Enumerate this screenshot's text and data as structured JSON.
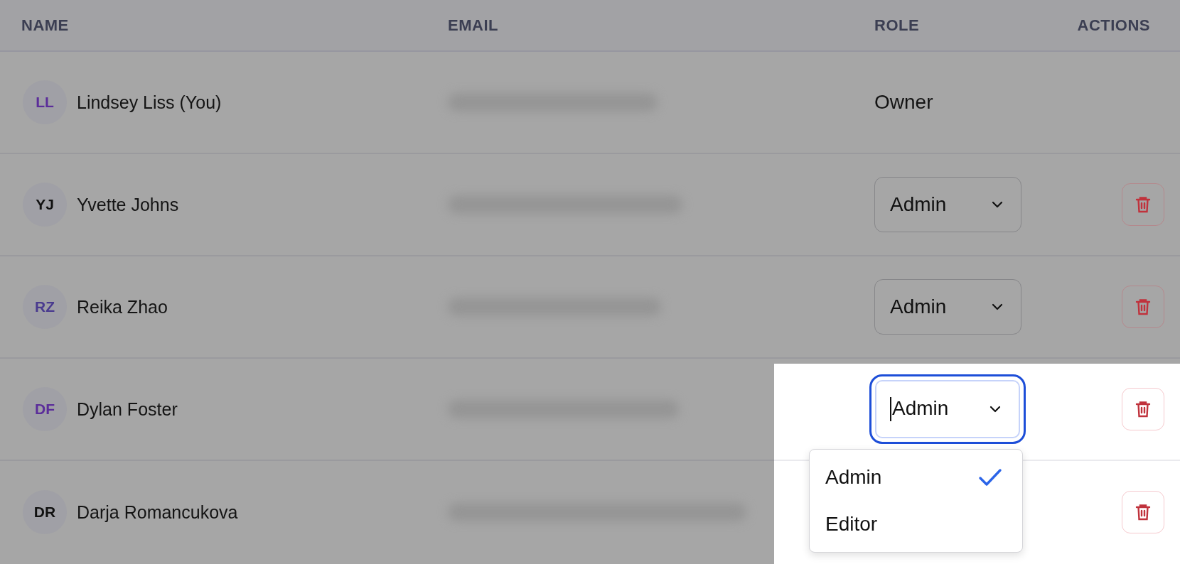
{
  "table": {
    "columns": [
      "NAME",
      "EMAIL",
      "ROLE",
      "ACTIONS"
    ],
    "rows": [
      {
        "initials": "LL",
        "name": "Lindsey Liss (You)",
        "color": "#5b2d9a",
        "role": {
          "kind": "text",
          "value": "Owner"
        },
        "deletable": false
      },
      {
        "initials": "YJ",
        "name": "Yvette Johns",
        "color": "#111111",
        "role": {
          "kind": "select",
          "value": "Admin",
          "focused": false
        },
        "deletable": true
      },
      {
        "initials": "RZ",
        "name": "Reika Zhao",
        "color": "#4a3b8f",
        "role": {
          "kind": "select",
          "value": "Admin",
          "focused": false
        },
        "deletable": true
      },
      {
        "initials": "DF",
        "name": "Dylan Foster",
        "color": "#5b2d9a",
        "role": {
          "kind": "select",
          "value": "Admin",
          "focused": true
        },
        "deletable": true
      },
      {
        "initials": "DR",
        "name": "Darja Romancukova",
        "color": "#111111",
        "deletable": true
      }
    ]
  },
  "dropdown": {
    "options": [
      {
        "label": "Admin",
        "selected": true
      },
      {
        "label": "Editor",
        "selected": false
      }
    ]
  }
}
